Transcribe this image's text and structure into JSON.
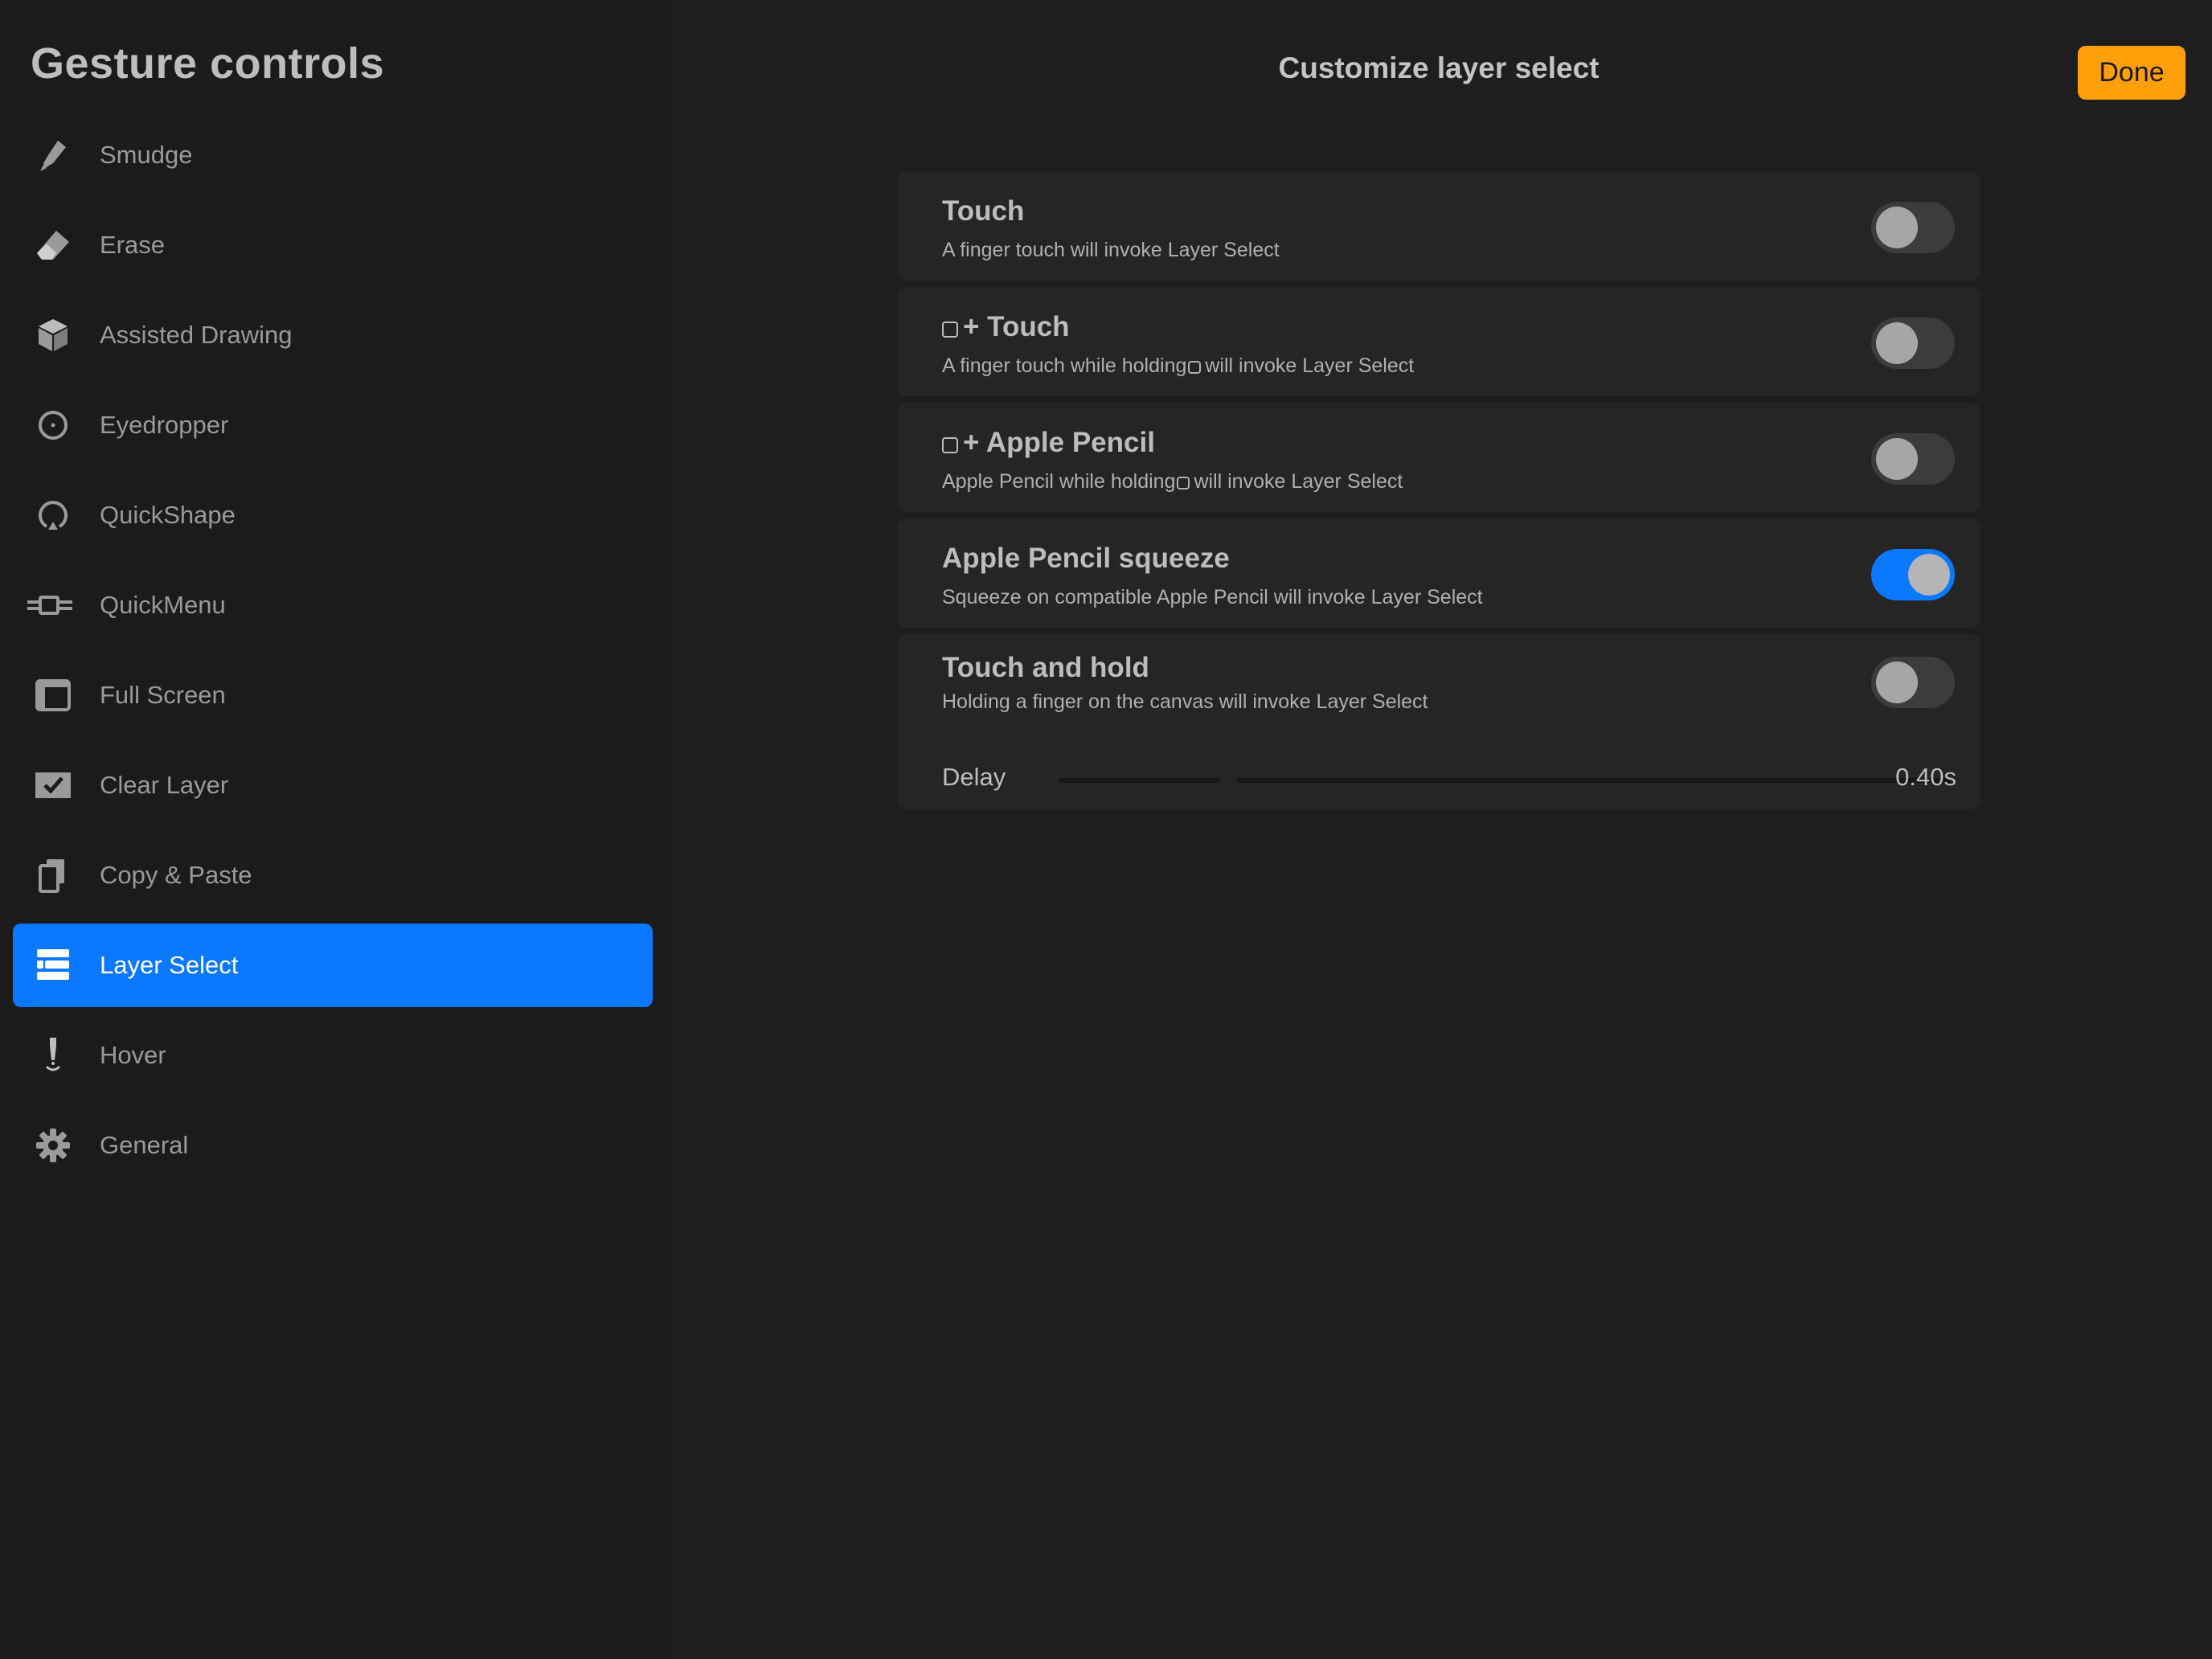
{
  "sidebar": {
    "title": "Gesture controls",
    "items": [
      {
        "label": "Smudge",
        "icon": "smudge-icon"
      },
      {
        "label": "Erase",
        "icon": "eraser-icon"
      },
      {
        "label": "Assisted Drawing",
        "icon": "cube-icon"
      },
      {
        "label": "Eyedropper",
        "icon": "eyedropper-icon"
      },
      {
        "label": "QuickShape",
        "icon": "quickshape-icon"
      },
      {
        "label": "QuickMenu",
        "icon": "quickmenu-icon"
      },
      {
        "label": "Full Screen",
        "icon": "fullscreen-icon"
      },
      {
        "label": "Clear Layer",
        "icon": "clear-layer-icon"
      },
      {
        "label": "Copy & Paste",
        "icon": "copy-paste-icon"
      },
      {
        "label": "Layer Select",
        "icon": "layers-icon",
        "active": true
      },
      {
        "label": "Hover",
        "icon": "hover-icon"
      },
      {
        "label": "General",
        "icon": "gear-icon"
      }
    ]
  },
  "header": {
    "title": "Customize layer select",
    "done_label": "Done"
  },
  "options": [
    {
      "title": "Touch",
      "description": "A finger touch will invoke Layer Select",
      "enabled": false
    },
    {
      "title": "+ Touch",
      "description_before": "A finger touch while holding",
      "description_after": "will invoke Layer Select",
      "enabled": false
    },
    {
      "title": "+ Apple Pencil",
      "description_before": "Apple Pencil while holding",
      "description_after": "will invoke Layer Select",
      "enabled": false
    },
    {
      "title": "Apple Pencil squeeze",
      "description": "Squeeze on compatible Apple Pencil will invoke Layer Select",
      "enabled": true
    },
    {
      "title": "Touch and hold",
      "description": "Holding a finger on the canvas will invoke Layer Select",
      "enabled": false,
      "delay": {
        "label": "Delay",
        "value": "0.40s"
      }
    }
  ],
  "colors": {
    "accent": "#0a78ff",
    "done": "#ff9f0a",
    "background": "#1e1e1e",
    "card": "#252525"
  }
}
